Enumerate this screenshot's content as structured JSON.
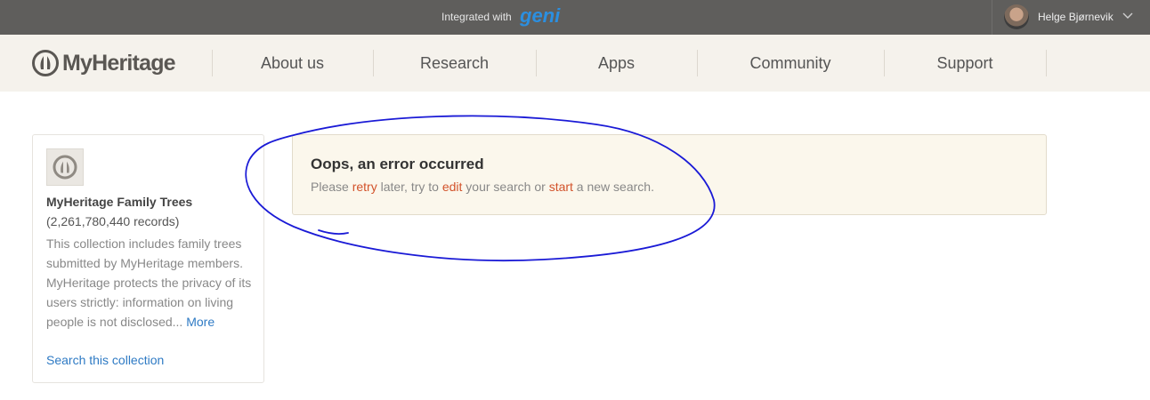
{
  "topbar": {
    "integrated_text": "Integrated with",
    "geni_logo_text": "Geni",
    "user_name": "Helge Bjørnevik"
  },
  "header": {
    "logo_text": "MyHeritage",
    "nav": [
      "About us",
      "Research",
      "Apps",
      "Community",
      "Support"
    ]
  },
  "card": {
    "title": "MyHeritage Family Trees",
    "records": "(2,261,780,440 records)",
    "description": "This collection includes family trees submitted by MyHeritage members. MyHeritage protects the privacy of its users strictly: information on living people is not disclosed...",
    "more_label": "More",
    "search_label": "Search this collection"
  },
  "error": {
    "title": "Oops, an error occurred",
    "msg_1": "Please ",
    "link_retry": "retry",
    "msg_2": " later, try to ",
    "link_edit": "edit",
    "msg_3": " your search or ",
    "link_start": "start",
    "msg_4": " a new search."
  },
  "colors": {
    "topbar_bg": "#5f5e5c",
    "header_bg": "#f5f2ec",
    "link_blue": "#2e7ac4",
    "link_orange": "#d2522a",
    "error_bg": "#fbf7ec",
    "annotation_blue": "#1a1ad6",
    "geni_blue": "#2b8fe0"
  },
  "icons": {
    "geni": "geni-logo",
    "avatar": "user-avatar",
    "chevron": "chevron-down-icon",
    "logo": "myheritage-logo-icon",
    "thumb": "collection-thumbnail-icon"
  }
}
